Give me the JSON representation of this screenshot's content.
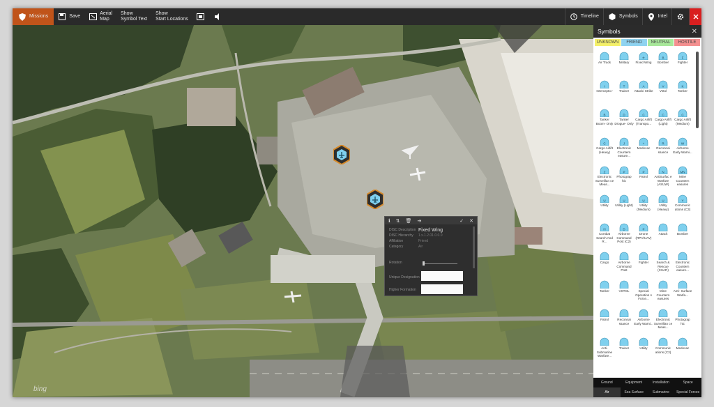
{
  "toolbar": {
    "missions": "Missions",
    "save": "Save",
    "aerial_map": "Aerial\nMap",
    "show_symbol_text": "Show\nSymbol Text",
    "show_start_locations": "Show\nStart Locations",
    "timeline": "Timeline",
    "symbols": "Symbols",
    "intel": "Intel"
  },
  "map": {
    "attribution": "bing"
  },
  "popup": {
    "rows": [
      {
        "key": "DISC Description",
        "value": "Fixed Wing"
      },
      {
        "key": "DISC Hierarchy",
        "value": "1.x.1.2.01.0.0.0"
      },
      {
        "key": "Affiliation",
        "value": "Friend"
      },
      {
        "key": "Category",
        "value": "Air"
      }
    ],
    "rotation_label": "Rotation",
    "unique_designation_label": "Unique Designation",
    "higher_formation_label": "Higher Formation"
  },
  "panel": {
    "title": "Symbols",
    "affiliations": [
      {
        "label": "UNKNOWN",
        "color": "#f4f06a"
      },
      {
        "label": "FRIEND",
        "color": "#8fd3f0"
      },
      {
        "label": "NEUTRAL",
        "color": "#a8e89a"
      },
      {
        "label": "HOSTILE",
        "color": "#f49090"
      }
    ],
    "symbols": [
      {
        "label": "Air Track",
        "glyph": ""
      },
      {
        "label": "Military",
        "glyph": ""
      },
      {
        "label": "Fixed Wing",
        "glyph": "✈"
      },
      {
        "label": "Bomber",
        "glyph": "B"
      },
      {
        "label": "Fighter",
        "glyph": "F"
      },
      {
        "label": "Intercepto r",
        "glyph": "I"
      },
      {
        "label": "Trainer",
        "glyph": "T"
      },
      {
        "label": "Attack/ Strike",
        "glyph": "A"
      },
      {
        "label": "Vstol",
        "glyph": "V"
      },
      {
        "label": "Tanker",
        "glyph": "K"
      },
      {
        "label": "Tanker Boom- Only",
        "glyph": "B"
      },
      {
        "label": "Tanker Drogue- Only",
        "glyph": "D"
      },
      {
        "label": "Cargo Airlift (Transpo...",
        "glyph": "C"
      },
      {
        "label": "Cargo Airlift (Light)",
        "glyph": "C"
      },
      {
        "label": "Cargo Airlift (Medium)",
        "glyph": "C"
      },
      {
        "label": "Cargo Airlift (Heavy)",
        "glyph": "C"
      },
      {
        "label": "Electronic Countern easure...",
        "glyph": "J"
      },
      {
        "label": "Medevac",
        "glyph": "+"
      },
      {
        "label": "Reconnai ssance",
        "glyph": "R"
      },
      {
        "label": "Airborne Early Warni...",
        "glyph": "W"
      },
      {
        "label": "Electronic Surveillan ce Meas...",
        "glyph": "Z"
      },
      {
        "label": "Photograp hic",
        "glyph": "P"
      },
      {
        "label": "Patrol",
        "glyph": "P"
      },
      {
        "label": "AntiSurfac e Warfare (ASUW)",
        "glyph": "N"
      },
      {
        "label": "Mine Countern easures",
        "glyph": "MN"
      },
      {
        "label": "Utility",
        "glyph": "U"
      },
      {
        "label": "Utility (Light)",
        "glyph": "U"
      },
      {
        "label": "Utility (Medium)",
        "glyph": "U"
      },
      {
        "label": "Utility (Heavy)",
        "glyph": "U"
      },
      {
        "label": "Communic ations (C3)",
        "glyph": "Y"
      },
      {
        "label": "Combat Search And R...",
        "glyph": "H"
      },
      {
        "label": "Airborne Command Post (C2)",
        "glyph": "D"
      },
      {
        "label": "Drone (RPV/UAV)",
        "glyph": "✈"
      },
      {
        "label": "Attack",
        "glyph": ""
      },
      {
        "label": "Bomber",
        "glyph": ""
      },
      {
        "label": "Cargo",
        "glyph": ""
      },
      {
        "label": "Airborne Command Post",
        "glyph": ""
      },
      {
        "label": "Fighter",
        "glyph": ""
      },
      {
        "label": "Search & Rescue (CSAR)",
        "glyph": ""
      },
      {
        "label": "Electronic Countern easure...",
        "glyph": ""
      },
      {
        "label": "Tanker",
        "glyph": ""
      },
      {
        "label": "VSTOL",
        "glyph": ""
      },
      {
        "label": "Special Operation s Force...",
        "glyph": ""
      },
      {
        "label": "Mine Countern easures",
        "glyph": ""
      },
      {
        "label": "Anti- Surface Warfa...",
        "glyph": ""
      },
      {
        "label": "Patrol",
        "glyph": ""
      },
      {
        "label": "Reconnai ssance",
        "glyph": ""
      },
      {
        "label": "Airborne Early Warni...",
        "glyph": ""
      },
      {
        "label": "Electronic Surveillan ce Meas...",
        "glyph": ""
      },
      {
        "label": "Photograp hic",
        "glyph": ""
      },
      {
        "label": "Anti- Submarine Warfare...",
        "glyph": ""
      },
      {
        "label": "Trainer",
        "glyph": ""
      },
      {
        "label": "Utility",
        "glyph": ""
      },
      {
        "label": "Communic ations (C3)",
        "glyph": ""
      },
      {
        "label": "Medevac",
        "glyph": ""
      }
    ],
    "categories": [
      "Ground",
      "Equipment",
      "Installation",
      "Space",
      "Air",
      "Sea Surface",
      "Submarine",
      "Special Forces"
    ],
    "selected_category": "Air"
  },
  "colors": {
    "friend_fill": "#7fd0ee",
    "marker_outline": "#d78a2a",
    "marker_fill": "#2e2e2e",
    "accent_missions": "#c0541a",
    "close_red": "#d91f1f"
  }
}
